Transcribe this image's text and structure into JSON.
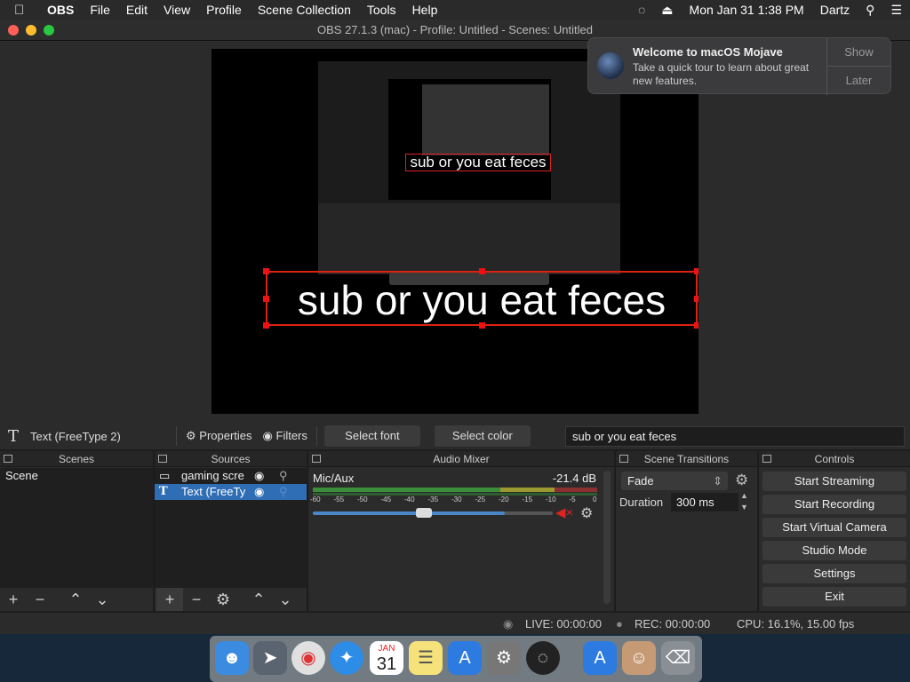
{
  "menubar": {
    "app": "OBS",
    "items": [
      "File",
      "Edit",
      "View",
      "Profile",
      "Scene Collection",
      "Tools",
      "Help"
    ],
    "clock": "Mon Jan 31  1:38 PM",
    "user": "Dartz"
  },
  "window": {
    "title": "OBS 27.1.3 (mac) - Profile: Untitled - Scenes: Untitled"
  },
  "preview": {
    "text_source": "sub or you eat feces"
  },
  "notification": {
    "title": "Welcome to macOS Mojave",
    "body": "Take a quick tour to learn about great new features.",
    "show_label": "Show",
    "later_label": "Later"
  },
  "source_toolbar": {
    "source_name": "Text (FreeType 2)",
    "properties_label": "Properties",
    "filters_label": "Filters",
    "select_font_label": "Select font",
    "select_color_label": "Select color",
    "text_value": "sub or you eat feces"
  },
  "scenes": {
    "header": "Scenes",
    "items": [
      "Scene"
    ]
  },
  "sources": {
    "header": "Sources",
    "items": [
      {
        "name": "gaming scre",
        "icon": "monitor-icon",
        "selected": false
      },
      {
        "name": "Text (FreeTy",
        "icon": "text-icon",
        "selected": true
      }
    ]
  },
  "audio_mixer": {
    "header": "Audio Mixer",
    "channel": "Mic/Aux",
    "level": "-21.4 dB",
    "ticks": [
      "-60",
      "-55",
      "-50",
      "-45",
      "-40",
      "-35",
      "-30",
      "-25",
      "-20",
      "-15",
      "-10",
      "-5",
      "0"
    ],
    "volume_fraction": 0.8
  },
  "transitions": {
    "header": "Scene Transitions",
    "selected": "Fade",
    "duration_label": "Duration",
    "duration_value": "300 ms"
  },
  "controls": {
    "header": "Controls",
    "buttons": [
      "Start Streaming",
      "Start Recording",
      "Start Virtual Camera",
      "Studio Mode",
      "Settings",
      "Exit"
    ]
  },
  "status": {
    "live": "LIVE: 00:00:00",
    "rec": "REC: 00:00:00",
    "cpu": "CPU: 16.1%, 15.00 fps"
  },
  "dock": {
    "calendar_month": "JAN",
    "calendar_day": "31"
  },
  "colors": {
    "selection": "#2f6db5",
    "handle_red": "#dd1111",
    "meter_green": "#4caf50"
  }
}
